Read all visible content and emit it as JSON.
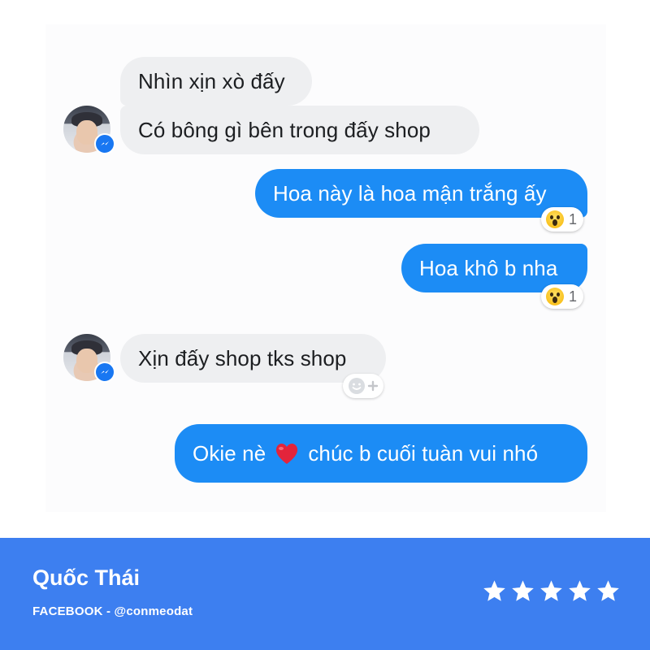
{
  "messages": [
    {
      "text": "Nhìn xịn xò đấy"
    },
    {
      "text": "Có bông gì bên trong đấy shop"
    },
    {
      "text": "Hoa này là hoa mận trắng ấy",
      "reaction_count": "1"
    },
    {
      "text": "Hoa khô b nha",
      "reaction_count": "1"
    },
    {
      "text": "Xịn đấy shop tks shop"
    },
    {
      "text_before": "Okie nè",
      "text_after": "chúc b cuối tuàn vui nhó"
    }
  ],
  "reviewer": {
    "name": "Quốc Thái",
    "source": "FACEBOOK - @conmeodat",
    "rating": 5
  },
  "colors": {
    "outgoing_bubble": "#1c8cf5",
    "incoming_bubble": "#eeeff1",
    "footer_bg": "#3d7ff0"
  }
}
